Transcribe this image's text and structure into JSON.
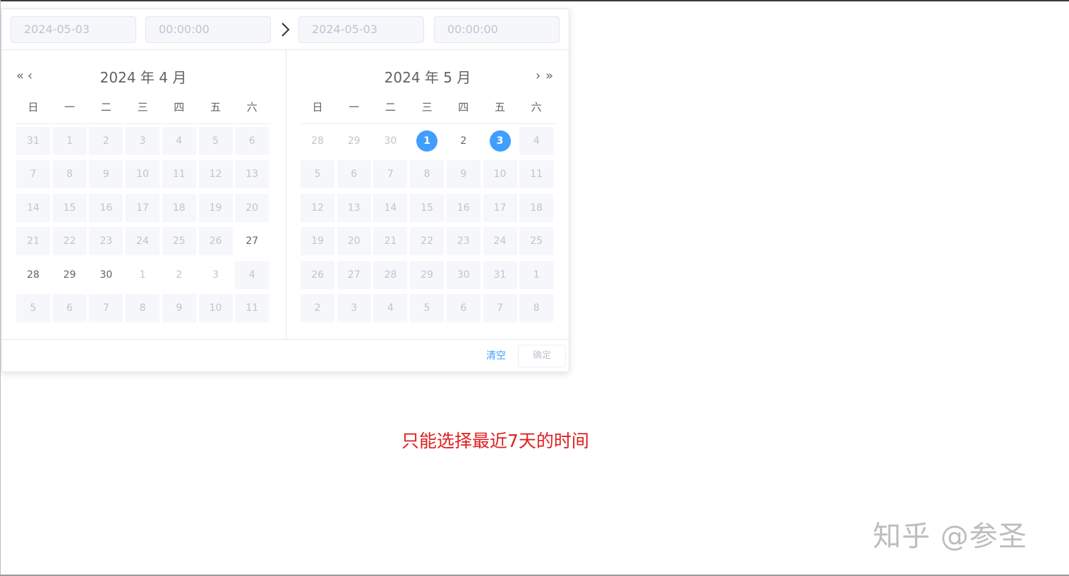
{
  "picker": {
    "start_date": "2024-05-03",
    "start_time": "00:00:00",
    "end_date": "2024-05-03",
    "end_time": "00:00:00",
    "left_title": "2024 年 4 月",
    "right_title": "2024 年 5 月",
    "nav": {
      "prev_year": "«",
      "prev_month": "‹",
      "next_month": "›",
      "next_year": "»"
    },
    "weekdays": [
      "日",
      "一",
      "二",
      "三",
      "四",
      "五",
      "六"
    ],
    "accent_color": "#409eff",
    "left_cells": [
      [
        "31",
        "1",
        "2",
        "3",
        "4",
        "5",
        "6"
      ],
      [
        "7",
        "8",
        "9",
        "10",
        "11",
        "12",
        "13"
      ],
      [
        "14",
        "15",
        "16",
        "17",
        "18",
        "19",
        "20"
      ],
      [
        "21",
        "22",
        "23",
        "24",
        "25",
        "26",
        "27"
      ],
      [
        "28",
        "29",
        "30",
        "1",
        "2",
        "3",
        "4"
      ],
      [
        "5",
        "6",
        "7",
        "8",
        "9",
        "10",
        "11"
      ]
    ],
    "left_states": [
      [
        "d",
        "d",
        "d",
        "d",
        "d",
        "d",
        "d"
      ],
      [
        "d",
        "d",
        "d",
        "d",
        "d",
        "d",
        "d"
      ],
      [
        "d",
        "d",
        "d",
        "d",
        "d",
        "d",
        "d"
      ],
      [
        "d",
        "d",
        "d",
        "d",
        "d",
        "d",
        "n"
      ],
      [
        "n",
        "n",
        "n",
        "f",
        "f",
        "f",
        "d"
      ],
      [
        "d",
        "d",
        "d",
        "d",
        "d",
        "d",
        "d"
      ]
    ],
    "right_cells": [
      [
        "28",
        "29",
        "30",
        "1",
        "2",
        "3",
        "4"
      ],
      [
        "5",
        "6",
        "7",
        "8",
        "9",
        "10",
        "11"
      ],
      [
        "12",
        "13",
        "14",
        "15",
        "16",
        "17",
        "18"
      ],
      [
        "19",
        "20",
        "21",
        "22",
        "23",
        "24",
        "25"
      ],
      [
        "26",
        "27",
        "28",
        "29",
        "30",
        "31",
        "1"
      ],
      [
        "2",
        "3",
        "4",
        "5",
        "6",
        "7",
        "8"
      ]
    ],
    "right_states": [
      [
        "f",
        "f",
        "f",
        "s",
        "n",
        "s",
        "d"
      ],
      [
        "d",
        "d",
        "d",
        "d",
        "d",
        "d",
        "d"
      ],
      [
        "d",
        "d",
        "d",
        "d",
        "d",
        "d",
        "d"
      ],
      [
        "d",
        "d",
        "d",
        "d",
        "d",
        "d",
        "d"
      ],
      [
        "d",
        "d",
        "d",
        "d",
        "d",
        "d",
        "d"
      ],
      [
        "d",
        "d",
        "d",
        "d",
        "d",
        "d",
        "d"
      ]
    ],
    "clear_label": "清空",
    "confirm_label": "确定"
  },
  "note": "只能选择最近7天的时间",
  "watermark": "知乎 @参圣"
}
